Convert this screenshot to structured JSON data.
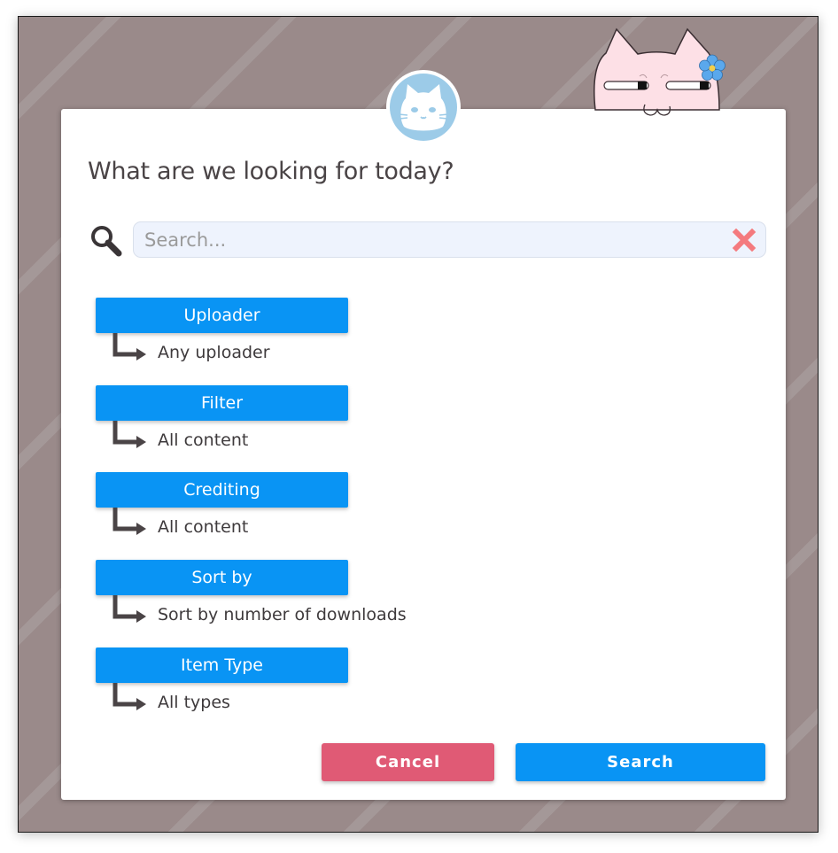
{
  "dialog": {
    "title": "What are we looking for today?",
    "search": {
      "placeholder": "Search...",
      "value": ""
    },
    "options": [
      {
        "label": "Uploader",
        "value": "Any uploader"
      },
      {
        "label": "Filter",
        "value": "All content"
      },
      {
        "label": "Crediting",
        "value": "All content"
      },
      {
        "label": "Sort by",
        "value": "Sort by number of downloads"
      },
      {
        "label": "Item Type",
        "value": "All types"
      }
    ],
    "buttons": {
      "cancel": "Cancel",
      "search": "Search"
    }
  },
  "icons": {
    "avatar": "cat-face-icon",
    "mascot": "pink-cat-mascot",
    "search": "magnifier-icon",
    "clear": "x-icon",
    "option_arrow": "turn-right-arrow-icon"
  },
  "colors": {
    "primary": "#0994f4",
    "cancel": "#e05a75",
    "clear": "#f47a7e",
    "backdrop": "#9a8a8a",
    "avatar": "#9ccbe8"
  }
}
